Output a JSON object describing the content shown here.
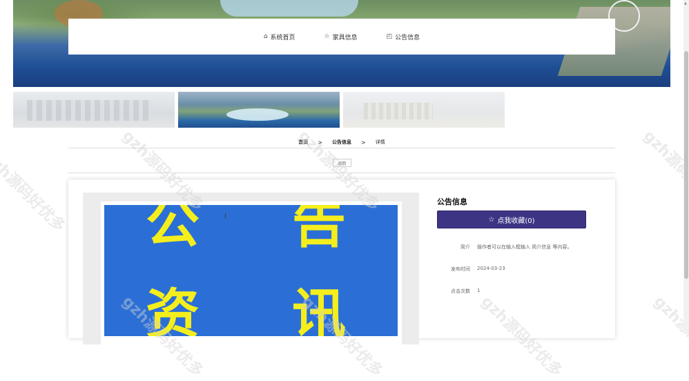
{
  "nav": {
    "items": [
      {
        "label": "系统首页",
        "icon": "home-icon"
      },
      {
        "label": "家具信息",
        "icon": "star-icon"
      },
      {
        "label": "公告信息",
        "icon": "bag-icon"
      }
    ]
  },
  "breadcrumb": {
    "home": "首页",
    "sep": ">",
    "section": "公告信息",
    "current": "详情"
  },
  "back_label": "返回",
  "detail": {
    "title": "公告信息",
    "favorite_label": "点我收藏(0)",
    "fields": [
      {
        "key": "简介",
        "value": "操作者可以在输入框输入 简介信息 等内容。"
      },
      {
        "key": "发布时间",
        "value": "2024-03-23"
      },
      {
        "key": "点击次数",
        "value": "1"
      }
    ]
  },
  "poster_chars": [
    "公",
    "告",
    "资",
    "讯"
  ],
  "watermark": "gzh源码好优多",
  "colors": {
    "accent": "#3d3584",
    "poster_bg": "#2b6fd6",
    "poster_text": "#f5ee1d"
  }
}
